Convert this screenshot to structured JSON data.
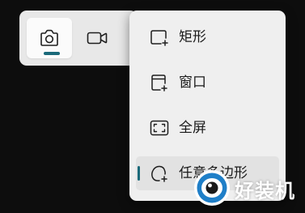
{
  "colors": {
    "accent": "#1b6a7a",
    "toolbar_bg": "#e8e8e8",
    "menu_bg": "#efefef",
    "selected_bg": "#e2e2e2",
    "page_bg": "#0d0d0d"
  },
  "toolbar": {
    "modes": [
      {
        "icon": "camera-icon",
        "selected": true
      },
      {
        "icon": "video-camera-icon",
        "selected": false
      }
    ]
  },
  "menu": {
    "items": [
      {
        "label": "矩形",
        "icon": "rectangle-snip-icon",
        "selected": false
      },
      {
        "label": "窗口",
        "icon": "window-snip-icon",
        "selected": false
      },
      {
        "label": "全屏",
        "icon": "fullscreen-snip-icon",
        "selected": false
      },
      {
        "label": "任意多边形",
        "icon": "freeform-snip-icon",
        "selected": true
      }
    ]
  },
  "watermark": {
    "text": "好装机",
    "logo": "eye-logo"
  }
}
